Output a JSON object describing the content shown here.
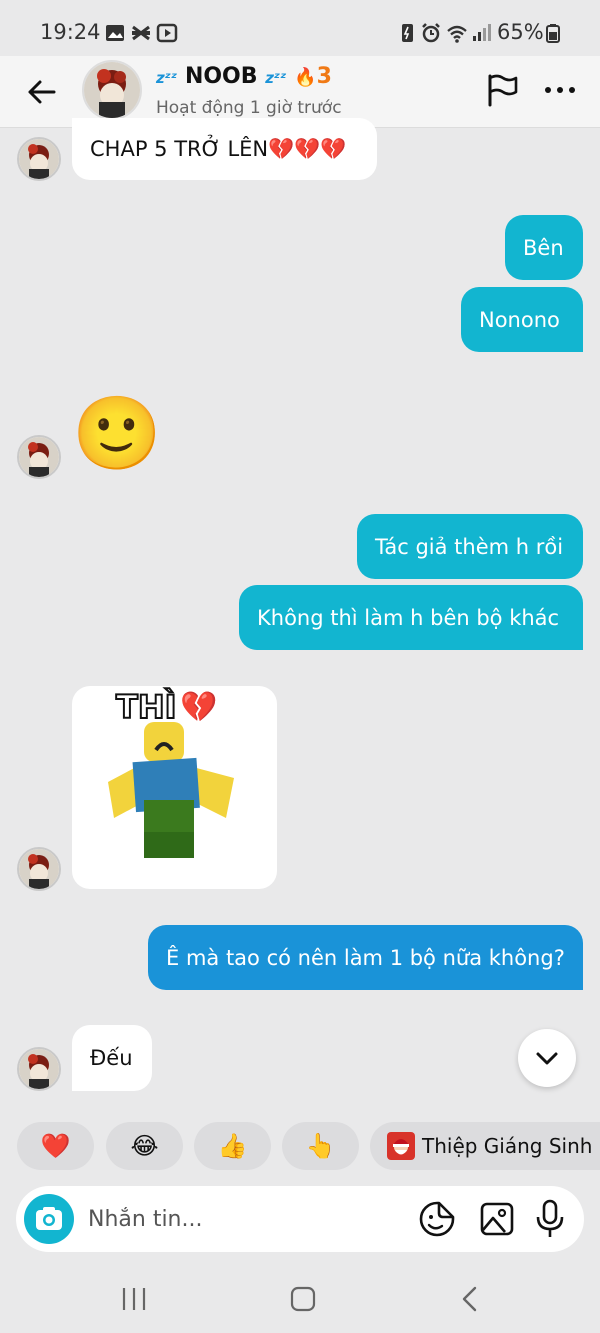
{
  "status_bar": {
    "time": "19:24",
    "battery": "65%"
  },
  "header": {
    "name": "NOOB",
    "streak": "3",
    "status": "Hoạt động 1 giờ trước"
  },
  "messages": [
    {
      "dir": "in",
      "text": "CHAP 5 TRỞ LÊN💔💔💔"
    },
    {
      "dir": "out",
      "text": "Bên"
    },
    {
      "dir": "out",
      "text": "Nonono"
    },
    {
      "dir": "in",
      "type": "emoji",
      "text": "🙂"
    },
    {
      "dir": "out",
      "text": "Tác giả thèm h rồi"
    },
    {
      "dir": "out",
      "text": "Không thì làm h bên bộ khác"
    },
    {
      "dir": "in",
      "type": "sticker",
      "text": "THÌ"
    },
    {
      "dir": "out",
      "text": "Ê mà tao có nên làm 1 bộ nữa không?"
    },
    {
      "dir": "in",
      "text": "Đếu"
    }
  ],
  "quick_replies": [
    "❤️",
    "😂",
    "👍",
    "👆",
    "Thiệp Giáng Sinh"
  ],
  "composer": {
    "placeholder": "Nhắn tin..."
  },
  "colors": {
    "outgoing": "#12b5d0",
    "outgoing_alt": "#1a93d8",
    "incoming": "#ffffff",
    "background": "#e9e9ea"
  }
}
